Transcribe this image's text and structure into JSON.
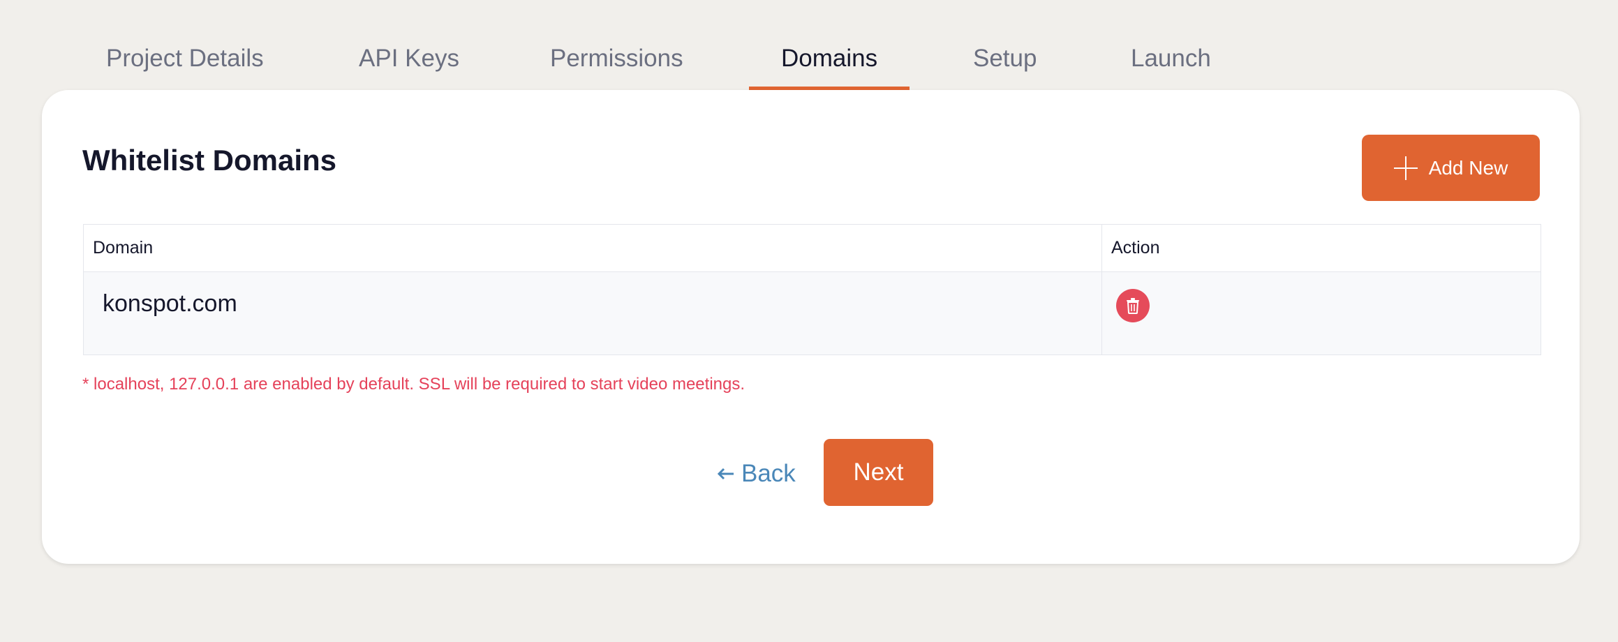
{
  "tabs": [
    {
      "label": "Project Details"
    },
    {
      "label": "API Keys"
    },
    {
      "label": "Permissions"
    },
    {
      "label": "Domains"
    },
    {
      "label": "Setup"
    },
    {
      "label": "Launch"
    }
  ],
  "active_tab": "Domains",
  "card": {
    "title": "Whitelist Domains",
    "add_button_label": "Add New",
    "table": {
      "headers": [
        "Domain",
        "Action"
      ],
      "rows": [
        {
          "domain": "konspot.com",
          "action_icon": "trash-icon"
        }
      ]
    },
    "note": "* localhost, 127.0.0.1 are enabled by default. SSL will be required to start video meetings.",
    "back_label": "Back",
    "next_label": "Next"
  },
  "colors": {
    "accent": "#e06431",
    "danger": "#e54b5a",
    "note": "#e5425a",
    "link": "#4a87b8",
    "background": "#f1efeb"
  }
}
